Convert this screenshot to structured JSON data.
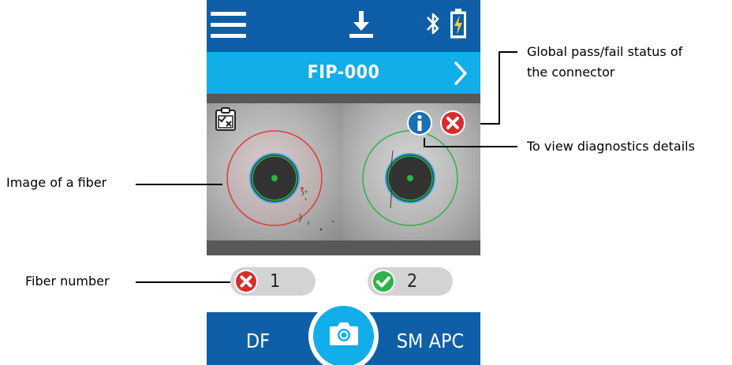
{
  "device": {
    "title": "FIP-000",
    "left_button_label": "DF",
    "right_button_label": "SM APC",
    "fibers": [
      {
        "number": "1",
        "status": "fail"
      },
      {
        "number": "2",
        "status": "pass"
      }
    ],
    "global_status": "fail",
    "colors": {
      "top_bar": "#0e5fa8",
      "title_bar": "#12aee9",
      "fail": "#d92b2b",
      "pass": "#2db34a",
      "info": "#1a6fb5"
    }
  },
  "callouts": {
    "global_status": "Global pass/fail status of\nthe connector",
    "global_status_line1": "Global pass/fail status of",
    "global_status_line2": "the connector",
    "diagnostics": "To view diagnostics details",
    "fiber_image": "Image of a fiber",
    "fiber_number": "Fiber number"
  },
  "icons": {
    "menu": "hamburger-menu-icon",
    "download": "download-icon",
    "bluetooth": "bluetooth-icon",
    "battery": "battery-charging-icon",
    "next": "chevron-right-icon",
    "report": "clipboard-report-icon",
    "info": "info-icon",
    "fail": "fail-x-icon",
    "pass": "pass-check-icon",
    "camera": "camera-icon"
  }
}
